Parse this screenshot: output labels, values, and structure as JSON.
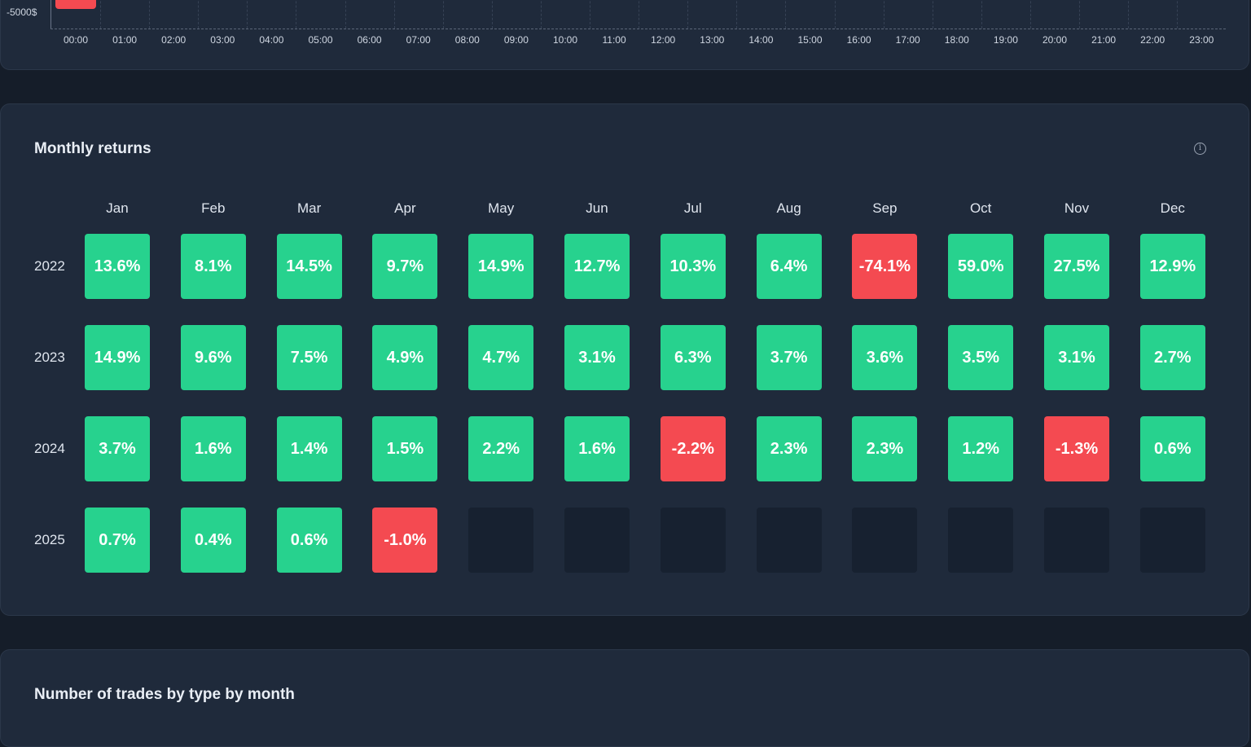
{
  "hourly_chart": {
    "y_label": "-5000$",
    "hours": [
      "00:00",
      "01:00",
      "02:00",
      "03:00",
      "04:00",
      "05:00",
      "06:00",
      "07:00",
      "08:00",
      "09:00",
      "10:00",
      "11:00",
      "12:00",
      "13:00",
      "14:00",
      "15:00",
      "16:00",
      "17:00",
      "18:00",
      "19:00",
      "20:00",
      "21:00",
      "22:00",
      "23:00"
    ],
    "negative_color": "#f44a51"
  },
  "monthly_returns": {
    "title": "Monthly returns",
    "info_icon": "info-circle-icon",
    "months": [
      "Jan",
      "Feb",
      "Mar",
      "Apr",
      "May",
      "Jun",
      "Jul",
      "Aug",
      "Sep",
      "Oct",
      "Nov",
      "Dec"
    ],
    "rows": [
      {
        "year": "2022",
        "values": [
          "13.6%",
          "8.1%",
          "14.5%",
          "9.7%",
          "14.9%",
          "12.7%",
          "10.3%",
          "6.4%",
          "-74.1%",
          "59.0%",
          "27.5%",
          "12.9%"
        ]
      },
      {
        "year": "2023",
        "values": [
          "14.9%",
          "9.6%",
          "7.5%",
          "4.9%",
          "4.7%",
          "3.1%",
          "6.3%",
          "3.7%",
          "3.6%",
          "3.5%",
          "3.1%",
          "2.7%"
        ]
      },
      {
        "year": "2024",
        "values": [
          "3.7%",
          "1.6%",
          "1.4%",
          "1.5%",
          "2.2%",
          "1.6%",
          "-2.2%",
          "2.3%",
          "2.3%",
          "1.2%",
          "-1.3%",
          "0.6%"
        ]
      },
      {
        "year": "2025",
        "values": [
          "0.7%",
          "0.4%",
          "0.6%",
          "-1.0%",
          "",
          "",
          "",
          "",
          "",
          "",
          "",
          ""
        ]
      }
    ],
    "positive_color": "#27d28e",
    "negative_color": "#f44a51",
    "empty_color": "#172130"
  },
  "trades_by_type": {
    "title": "Number of trades by type by month"
  }
}
